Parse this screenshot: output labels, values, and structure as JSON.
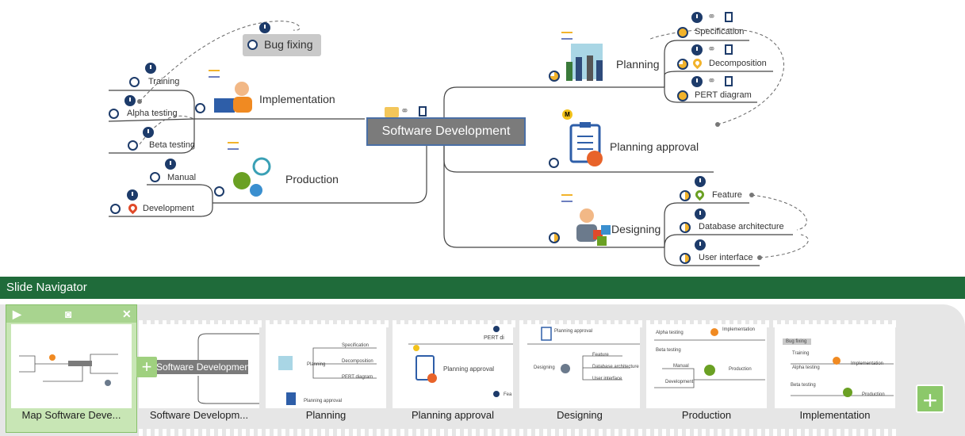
{
  "mindmap": {
    "central_topic": "Software Development",
    "branches": {
      "implementation": "Implementation",
      "production": "Production",
      "planning": "Planning",
      "planning_approval": "Planning approval",
      "designing": "Designing"
    },
    "subtopics": {
      "bug_fixing": "Bug fixing",
      "training": "Training",
      "alpha_testing": "Alpha testing",
      "beta_testing": "Beta testing",
      "manual": "Manual",
      "development": "Development",
      "specification": "Specification",
      "decomposition": "Decomposition",
      "pert_diagram": "PERT diagram",
      "feature": "Feature",
      "database_architecture": "Database architecture",
      "user_interface": "User interface"
    },
    "milestone_marker": "M"
  },
  "slide_navigator": {
    "title": "Slide Navigator",
    "slides": [
      {
        "label": "Map Software Deve...",
        "selected": true
      },
      {
        "label": "Software Developm..."
      },
      {
        "label": "Planning"
      },
      {
        "label": "Planning approval"
      },
      {
        "label": "Designing"
      },
      {
        "label": "Production"
      },
      {
        "label": "Implementation"
      }
    ],
    "thumb_text": {
      "software_development": "Software Development",
      "planning": "Planning",
      "specification": "Specification",
      "decomposition": "Decomposition",
      "pert_diagram": "PERT diagram",
      "planning_approval": "Planning approval",
      "pert_short": "PERT di",
      "feature_short": "Fea",
      "designing": "Designing",
      "feature": "Feature",
      "database_architecture": "Database architecture",
      "user_interface": "User interface",
      "alpha_testing": "Alpha testing",
      "implementation": "Implementation",
      "beta_testing": "Beta testing",
      "manual": "Manual",
      "production": "Production",
      "development": "Development",
      "bug_fixing": "Bug fixing",
      "training": "Training"
    },
    "icons": [
      "play-icon",
      "camera-icon",
      "close-icon",
      "add-icon"
    ]
  }
}
